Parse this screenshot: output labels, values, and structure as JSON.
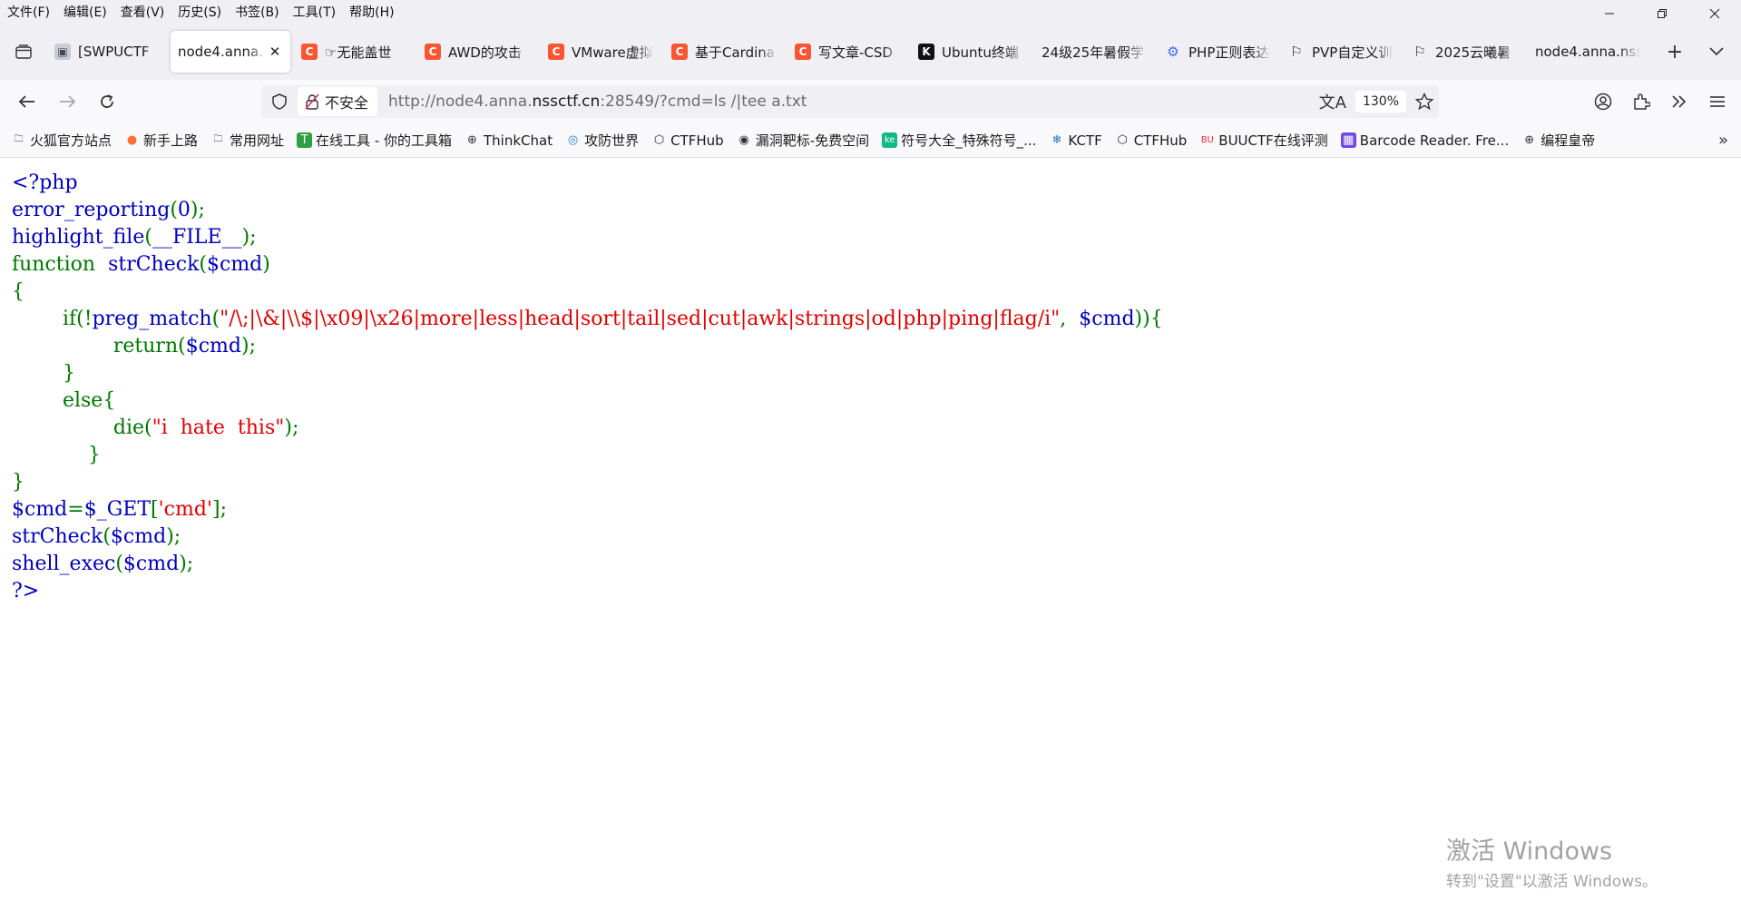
{
  "menubar": {
    "items": [
      "文件(F)",
      "编辑(E)",
      "查看(V)",
      "历史(S)",
      "书签(B)",
      "工具(T)",
      "帮助(H)"
    ],
    "window_controls": [
      "minimize-icon",
      "restore-icon",
      "close-icon"
    ]
  },
  "tabs": [
    {
      "label": "[SWPUCTF",
      "favicon": "vm-icon",
      "active": false
    },
    {
      "label": "node4.anna.",
      "favicon": "none",
      "active": true
    },
    {
      "label": "☞无能盖世",
      "favicon": "csdn-icon",
      "active": false
    },
    {
      "label": "AWD的攻击",
      "favicon": "csdn-icon",
      "active": false
    },
    {
      "label": "VMware虚拟",
      "favicon": "csdn-icon",
      "active": false
    },
    {
      "label": "基于Cardina",
      "favicon": "csdn-icon",
      "active": false
    },
    {
      "label": "写文章-CSD",
      "favicon": "csdn-icon",
      "active": false
    },
    {
      "label": "Ubuntu终端",
      "favicon": "k-icon",
      "active": false
    },
    {
      "label": "24级25年暑假学",
      "favicon": "none",
      "active": false
    },
    {
      "label": "PHP正则表达",
      "favicon": "php-icon",
      "active": false
    },
    {
      "label": "PVP自定义训",
      "favicon": "flag-icon",
      "active": false
    },
    {
      "label": "2025云曦暑",
      "favicon": "flag-icon",
      "active": false
    },
    {
      "label": "node4.anna.nss",
      "favicon": "none",
      "active": false
    }
  ],
  "navbar": {
    "security_label": "不安全",
    "url_prefix": "http://node4.anna.",
    "url_host": "nssctf.cn",
    "url_suffix": ":28549/?cmd=ls /|tee a.txt",
    "zoom": "130%"
  },
  "bookmarks": [
    {
      "label": "火狐官方站点",
      "icon": "folder-icon"
    },
    {
      "label": "新手上路",
      "icon": "firefox-icon"
    },
    {
      "label": "常用网址",
      "icon": "folder-icon"
    },
    {
      "label": "在线工具 - 你的工具箱",
      "icon": "tool-icon"
    },
    {
      "label": "ThinkChat",
      "icon": "globe-icon"
    },
    {
      "label": "攻防世界",
      "icon": "adworld-icon"
    },
    {
      "label": "CTFHub",
      "icon": "cube-icon"
    },
    {
      "label": "漏洞靶标-免费空间",
      "icon": "bug-icon"
    },
    {
      "label": "符号大全_特殊符号_...",
      "icon": "ke-icon"
    },
    {
      "label": "KCTF",
      "icon": "snowflake-icon"
    },
    {
      "label": "CTFHub",
      "icon": "cube-icon"
    },
    {
      "label": "BUUCTF在线评测",
      "icon": "buu-icon"
    },
    {
      "label": "Barcode Reader. Fre...",
      "icon": "barcode-icon"
    },
    {
      "label": "编程皇帝",
      "icon": "globe-icon"
    }
  ],
  "code": {
    "l1": "<?php",
    "l2a": "error_reporting",
    "l2b": "(",
    "l2c": "0",
    "l2d": ");",
    "l3a": "highlight_file",
    "l3b": "(",
    "l3c": "__FILE__",
    "l3d": ");",
    "l4a": "function",
    "l4b": "  strCheck",
    "l4c": "(",
    "l4d": "$cmd",
    "l4e": ")",
    "l5": "{",
    "l6a": "        if(!",
    "l6b": "preg_match",
    "l6c": "(",
    "l6d": "\"/\\;|\\&|\\\\$|\\x09|\\x26|more|less|head|sort|tail|sed|cut|awk|strings|od|php|ping|flag/i\"",
    "l6e": ",  ",
    "l6f": "$cmd",
    "l6g": ")){",
    "l7a": "                return(",
    "l7b": "$cmd",
    "l7c": ");",
    "l8": "        }",
    "l9": "        else{",
    "l10a": "                die(",
    "l10b": "\"i  hate  this\"",
    "l10c": ");",
    "l11": "            }",
    "l12": "}",
    "l13a": "$cmd",
    "l13b": "=",
    "l13c": "$_GET",
    "l13d": "[",
    "l13e": "'cmd'",
    "l13f": "];",
    "l14a": "strCheck",
    "l14b": "(",
    "l14c": "$cmd",
    "l14d": ");",
    "l15a": "shell_exec",
    "l15b": "(",
    "l15c": "$cmd",
    "l15d": ");",
    "l16": "?>"
  },
  "watermark": {
    "line1": "激活 Windows",
    "line2": "转到\"设置\"以激活 Windows。"
  }
}
